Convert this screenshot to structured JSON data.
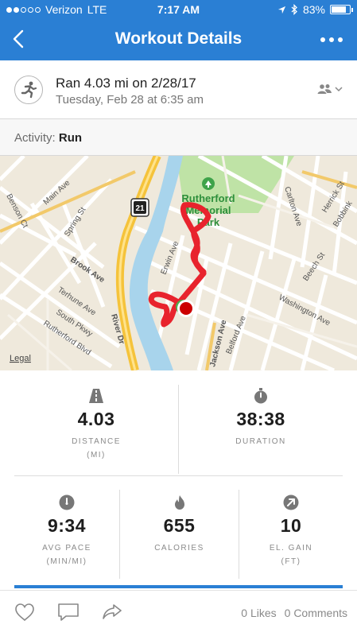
{
  "status_bar": {
    "carrier": "Verizon",
    "network": "LTE",
    "time": "7:17 AM",
    "battery": "83%",
    "battery_level": 0.83,
    "signal_bars": 2,
    "signal_total": 5
  },
  "nav": {
    "title": "Workout Details",
    "back_icon": "chevron-left-icon",
    "more_icon": "more-dots-icon"
  },
  "workout": {
    "title": "Ran 4.03 mi on 2/28/17",
    "date": "Tuesday, Feb 28 at 6:35 am",
    "activity_icon": "runner-icon",
    "privacy_icon": "friends-privacy-icon"
  },
  "activity": {
    "prefix": "Activity:",
    "value": "Run"
  },
  "map": {
    "park_label_1": "Rutherford",
    "park_label_2": "Memorial",
    "park_label_3": "Park",
    "legal": "Legal",
    "route_shield": "21",
    "streets": [
      "Main Ave",
      "Benson Ct",
      "Spring St",
      "Brook Ave",
      "Terhune Ave",
      "South Pkwy",
      "Rutherford Blvd",
      "River Dr",
      "Erwin Ave",
      "Jackson Ave",
      "Belford Ave",
      "Washington Ave",
      "Beech St",
      "Carlton Ave",
      "Herrick St",
      "Bobbink"
    ],
    "colors": {
      "route": "#e8232d",
      "river": "#a8d4ec",
      "park": "#bfe3a6",
      "highway": "#f5c33b"
    }
  },
  "stats": {
    "distance": {
      "value": "4.03",
      "label": "DISTANCE",
      "unit": "(MI)",
      "icon": "road-icon"
    },
    "duration": {
      "value": "38:38",
      "label": "DURATION",
      "unit": "",
      "icon": "stopwatch-icon"
    },
    "avg_pace": {
      "value": "9:34",
      "label": "AVG PACE",
      "unit": "(MIN/MI)",
      "icon": "speedometer-icon"
    },
    "calories": {
      "value": "655",
      "label": "CALORIES",
      "unit": "",
      "icon": "flame-icon"
    },
    "elevation": {
      "value": "10",
      "label": "EL. GAIN",
      "unit": "(FT)",
      "icon": "elevation-arrow-icon"
    }
  },
  "social": {
    "likes": "0 Likes",
    "comments": "0 Comments",
    "like_icon": "heart-icon",
    "comment_icon": "comment-icon",
    "share_icon": "share-icon"
  },
  "colors": {
    "primary": "#2a7fd4",
    "icon_grey": "#777777"
  }
}
